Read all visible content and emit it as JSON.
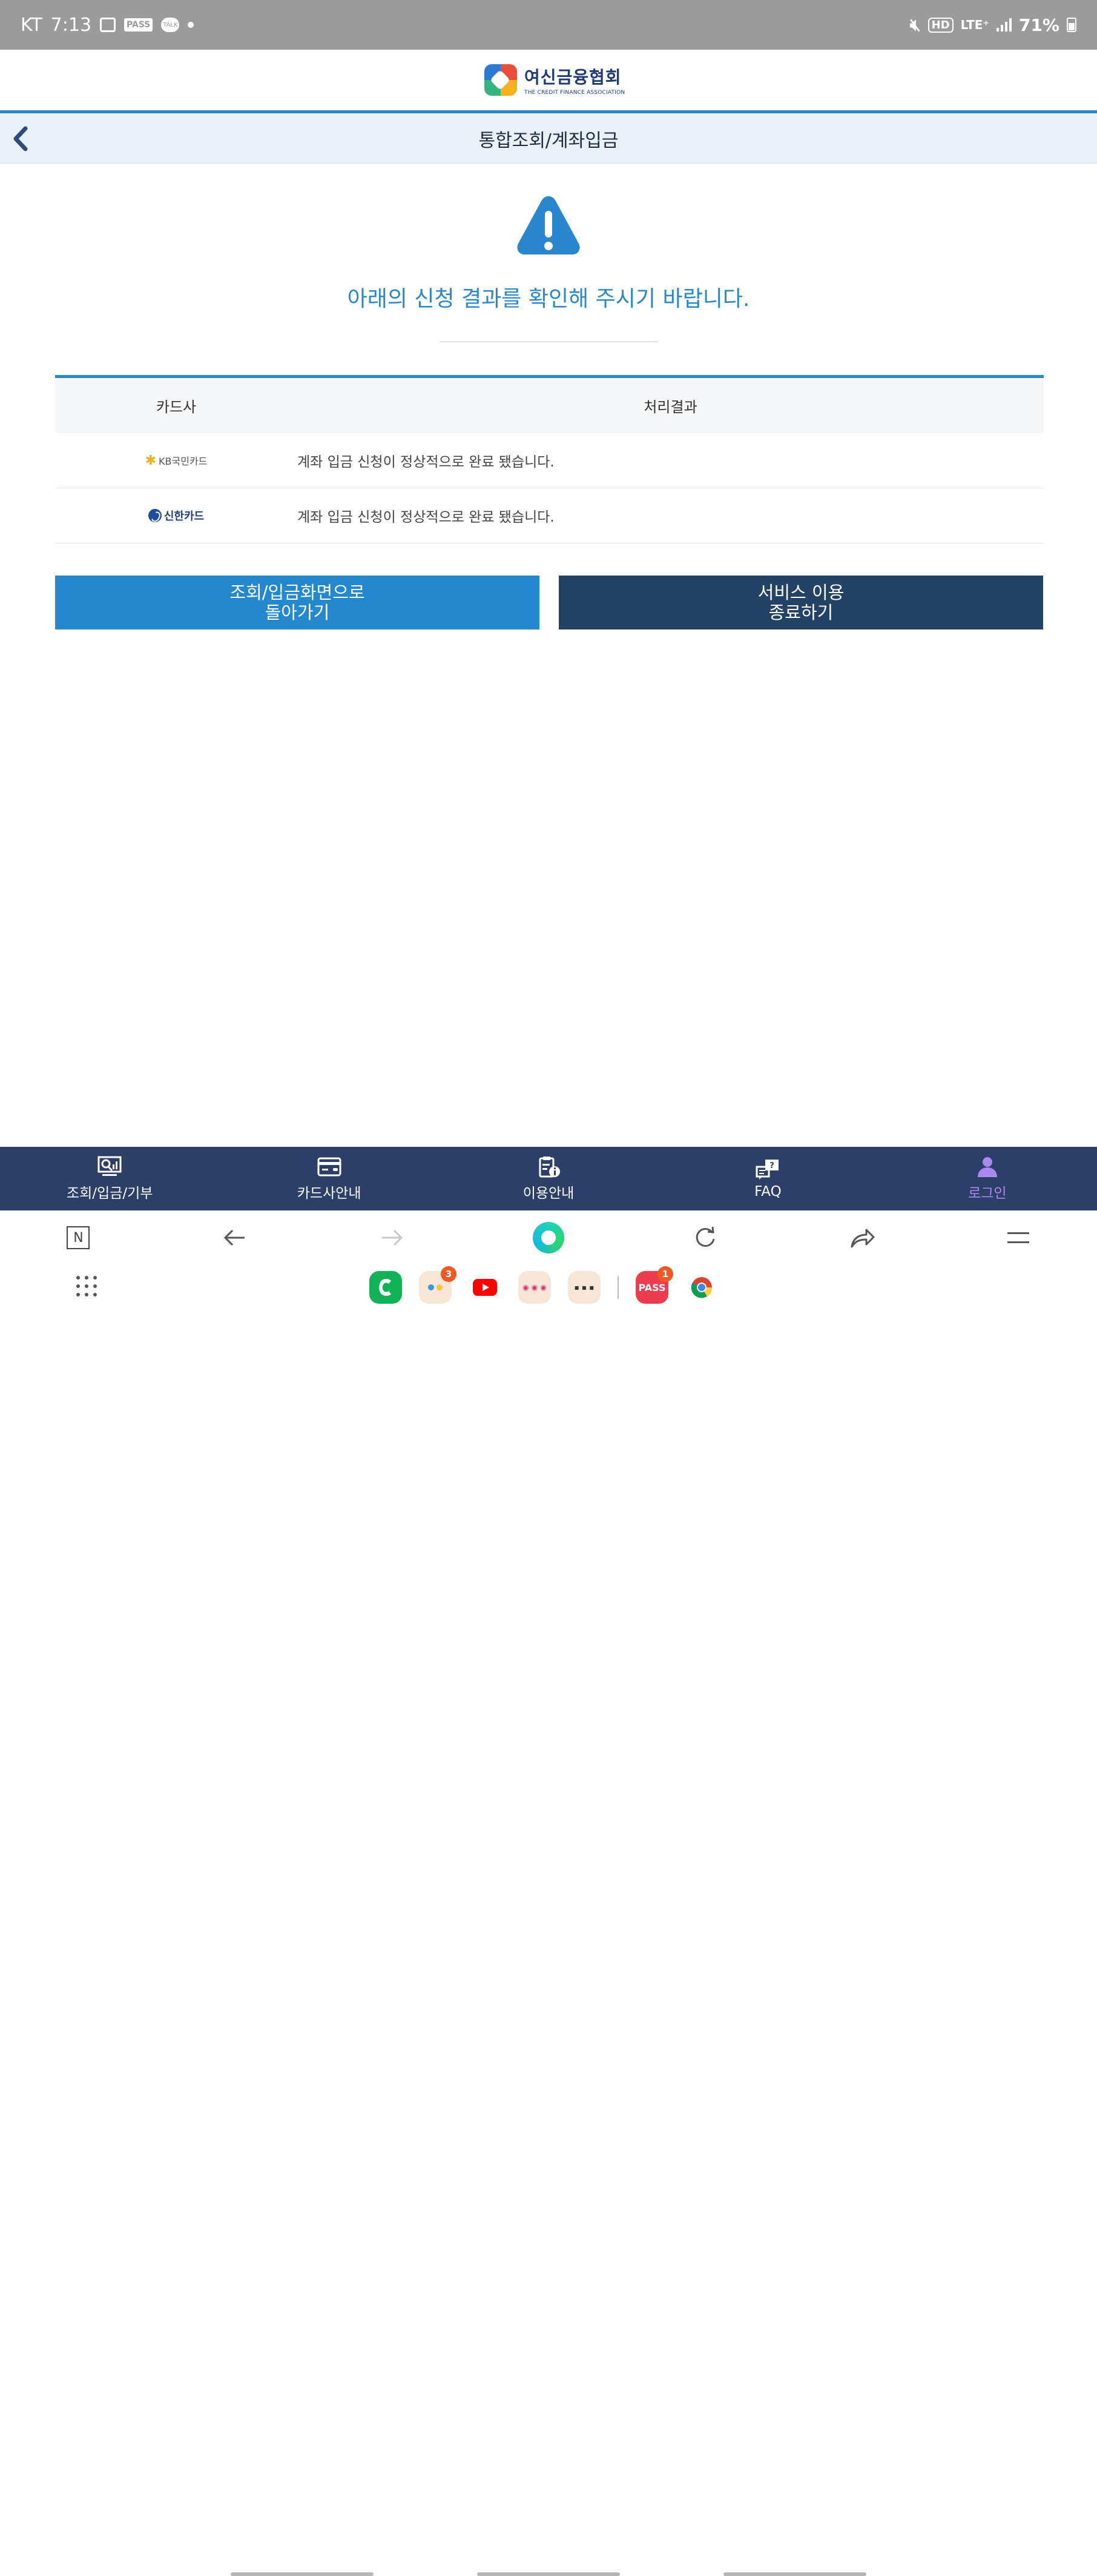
{
  "status_bar": {
    "carrier": "KT",
    "time": "7:13",
    "pass_label": "PASS",
    "talk_label": "TALK",
    "hd_label": "HD",
    "network_label": "LTE⁺",
    "battery": "71%"
  },
  "header": {
    "logo_korean": "여신금융협회",
    "logo_english": "THE CREDIT FINANCE ASSOCIATION"
  },
  "title_bar": {
    "back_icon": "chevron-left-icon",
    "title": "통합조회/계좌입금"
  },
  "alert": {
    "icon": "warning-icon",
    "color": "#2a87cd",
    "message": "아래의 신청 결과를 확인해 주시기 바랍니다."
  },
  "result_table": {
    "headers": {
      "card": "카드사",
      "result": "처리결과"
    },
    "rows": [
      {
        "card_logo_text": "KB국민카드",
        "result": "계좌 입금 신청이 정상적으로 완료 됐습니다."
      },
      {
        "card_logo_text": "신한카드",
        "result": "계좌 입금 신청이 정상적으로 완료 됐습니다."
      }
    ]
  },
  "buttons": {
    "back_line1": "조회/입금화면으로",
    "back_line2": "돌아가기",
    "exit_line1": "서비스 이용",
    "exit_line2": "종료하기",
    "back_color": "#2488ce",
    "exit_color": "#234366"
  },
  "bottom_nav": {
    "items": [
      {
        "label": "조회/입금/기부",
        "icon": "search-chart-icon"
      },
      {
        "label": "카드사안내",
        "icon": "credit-card-icon"
      },
      {
        "label": "이용안내",
        "icon": "clipboard-info-icon"
      },
      {
        "label": "FAQ",
        "icon": "faq-chat-icon"
      },
      {
        "label": "로그인",
        "icon": "user-icon",
        "active": true
      }
    ],
    "background": "#2d3e68",
    "active_color": "#a989ef"
  },
  "browser_bar": {
    "n_label": "N",
    "icons": [
      "naver-n-icon",
      "back-arrow-icon",
      "forward-arrow-icon",
      "home-icon",
      "reload-icon",
      "share-icon",
      "menu-icon"
    ]
  },
  "dock": {
    "badges": {
      "folder1": "3",
      "pass": "1"
    },
    "pass_label": "PASS"
  }
}
